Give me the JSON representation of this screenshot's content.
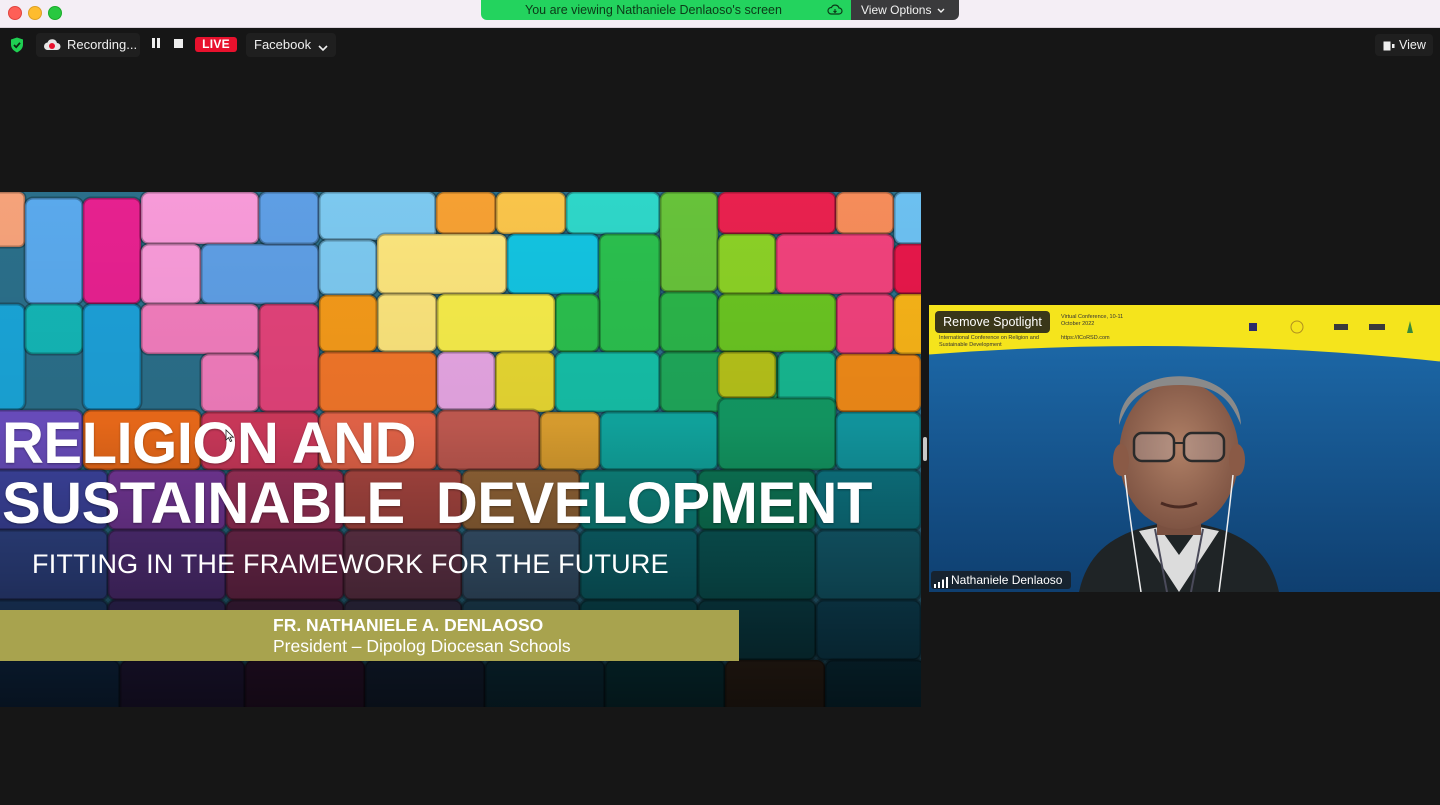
{
  "window": {
    "share_banner": "You are viewing Nathaniele Denlaoso's screen",
    "view_options": "View Options"
  },
  "toolbar": {
    "recording_label": "Recording...",
    "live_label": "LIVE",
    "stream_destination": "Facebook",
    "view_label": "View"
  },
  "slide": {
    "title_line1": "RELIGION AND",
    "title_line2": "SUSTAINABLE  DEVELOPMENT",
    "subtitle": "FITTING IN THE FRAMEWORK FOR THE FUTURE",
    "presenter_name": "FR. NATHANIELE A. DENLAOSO",
    "presenter_role": "President – Dipolog Diocesan Schools"
  },
  "speaker": {
    "spotlight_button": "Remove Spotlight",
    "name": "Nathaniele Denlaoso",
    "background_text_1": "International Conference on Religion and Sustainable Development",
    "background_text_2": "Virtual Conference, 10-11 October 2022",
    "background_text_3": "https://ICoRSD.com"
  },
  "colors": {
    "live_red": "#e8112d",
    "share_green": "#23d35e",
    "banner_olive": "#a8a34e",
    "background": "#161616"
  }
}
